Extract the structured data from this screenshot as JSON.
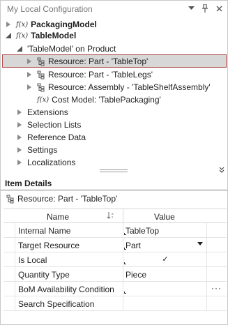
{
  "panel": {
    "title": "My Local Configuration",
    "title_icons": [
      "dropdown-icon",
      "pin-icon",
      "close-icon"
    ]
  },
  "tree": {
    "items": [
      {
        "label": "PackagingModel",
        "bold": true,
        "expanded": false,
        "icon": "fx-icon"
      },
      {
        "label": "TableModel",
        "bold": true,
        "expanded": true,
        "icon": "fx-icon"
      },
      {
        "label": "'TableModel' on Product",
        "bold": false,
        "expanded": true
      },
      {
        "label": "Resource: Part - 'TableTop'",
        "selected": true,
        "icon": "resource-tree-icon"
      },
      {
        "label": "Resource: Part - 'TableLegs'",
        "icon": "resource-tree-icon"
      },
      {
        "label": "Resource: Assembly - 'TableShelfAssembly'",
        "icon": "resource-tree-icon"
      },
      {
        "label": "Cost Model: 'TablePackaging'",
        "icon": "fx-icon"
      },
      {
        "label": "Extensions"
      },
      {
        "label": "Selection Lists"
      },
      {
        "label": "Reference Data"
      },
      {
        "label": "Settings"
      },
      {
        "label": "Localizations"
      }
    ]
  },
  "details": {
    "header": "Item Details",
    "subtitle": "Resource: Part - 'TableTop'",
    "columns": {
      "name": "Name",
      "value": "Value"
    },
    "rows": [
      {
        "name": "Internal Name",
        "value": "TableTop"
      },
      {
        "name": "Target Resource",
        "value": "Part"
      },
      {
        "name": "Is Local",
        "value": "",
        "checked": true
      },
      {
        "name": "Quantity Type",
        "value": "Piece"
      },
      {
        "name": "BoM Availability Condition",
        "value": ""
      },
      {
        "name": "Search Specification",
        "value": ""
      }
    ],
    "fx_glyph": "f(x)",
    "check_glyph": "✓",
    "ellipsis": "···",
    "sort_glyph": "↓",
    "collapse_glyph": "»"
  }
}
